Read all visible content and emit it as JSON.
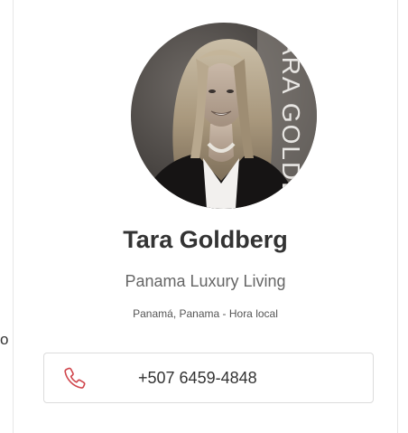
{
  "agent": {
    "name": "Tara Goldberg",
    "agency": "Panama Luxury Living",
    "location": "Panamá, Panama - Hora local",
    "phone": "+507 6459-4848",
    "photo_watermark": "TARA GOLDBERG"
  },
  "page": {
    "left_fragment": "o"
  },
  "icons": {
    "phone": "phone-icon"
  },
  "colors": {
    "phone_icon": "#d0454c",
    "name_text": "#333333",
    "agency_text": "#666666",
    "border": "#dcdcdc"
  }
}
